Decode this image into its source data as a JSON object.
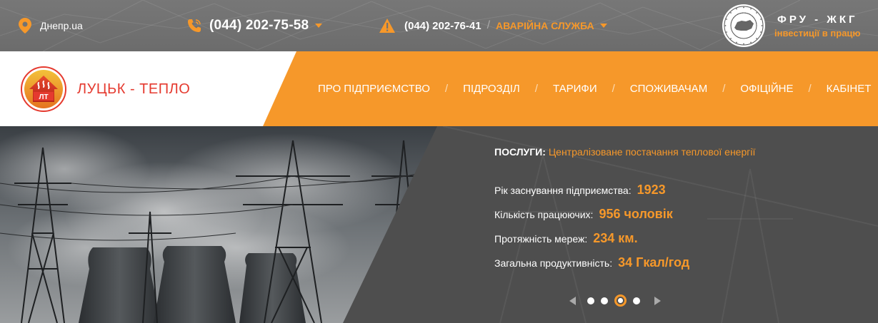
{
  "topbar": {
    "city": "Днепр.ua",
    "phone": "(044) 202-75-58",
    "emergency_phone": "(044) 202-76-41",
    "emergency_separator": "/",
    "emergency_label": "АВАРІЙНА СЛУЖБА",
    "fru_title": "ФРУ - ЖКГ",
    "fru_subtitle": "інвестиції в працю",
    "icons": [
      "location-pin-icon",
      "phone-icon",
      "warning-icon",
      "caret-down-icon"
    ]
  },
  "logo": {
    "emblem_text": "ЛТ",
    "name": "ЛУЦЬК - ТЕПЛО"
  },
  "nav": {
    "items": [
      "ПРО ПІДПРИЄМСТВО",
      "ПІДРОЗДІЛ",
      "ТАРИФИ",
      "СПОЖИВАЧАМ",
      "ОФІЦІЙНЕ",
      "КАБІНЕТ"
    ],
    "separator": "/"
  },
  "hero": {
    "service_label": "ПОСЛУГИ:",
    "service_value": "Централізоване постачання теплової енергії",
    "stats": [
      {
        "label": "Рік заснування підприємства:",
        "value": "1923"
      },
      {
        "label": "Кількість працюючих:",
        "value": "956 чоловік"
      },
      {
        "label": "Протяжність мереж:",
        "value": "234 км."
      },
      {
        "label": "Загальна продуктивність:",
        "value": "34 Гкал/год"
      }
    ],
    "slider": {
      "total": 4,
      "active_index": 2
    }
  },
  "colors": {
    "accent": "#f6982a",
    "logo_red": "#e53a2f",
    "topbar": "#737373",
    "hero_bg": "#4f4f4f"
  }
}
